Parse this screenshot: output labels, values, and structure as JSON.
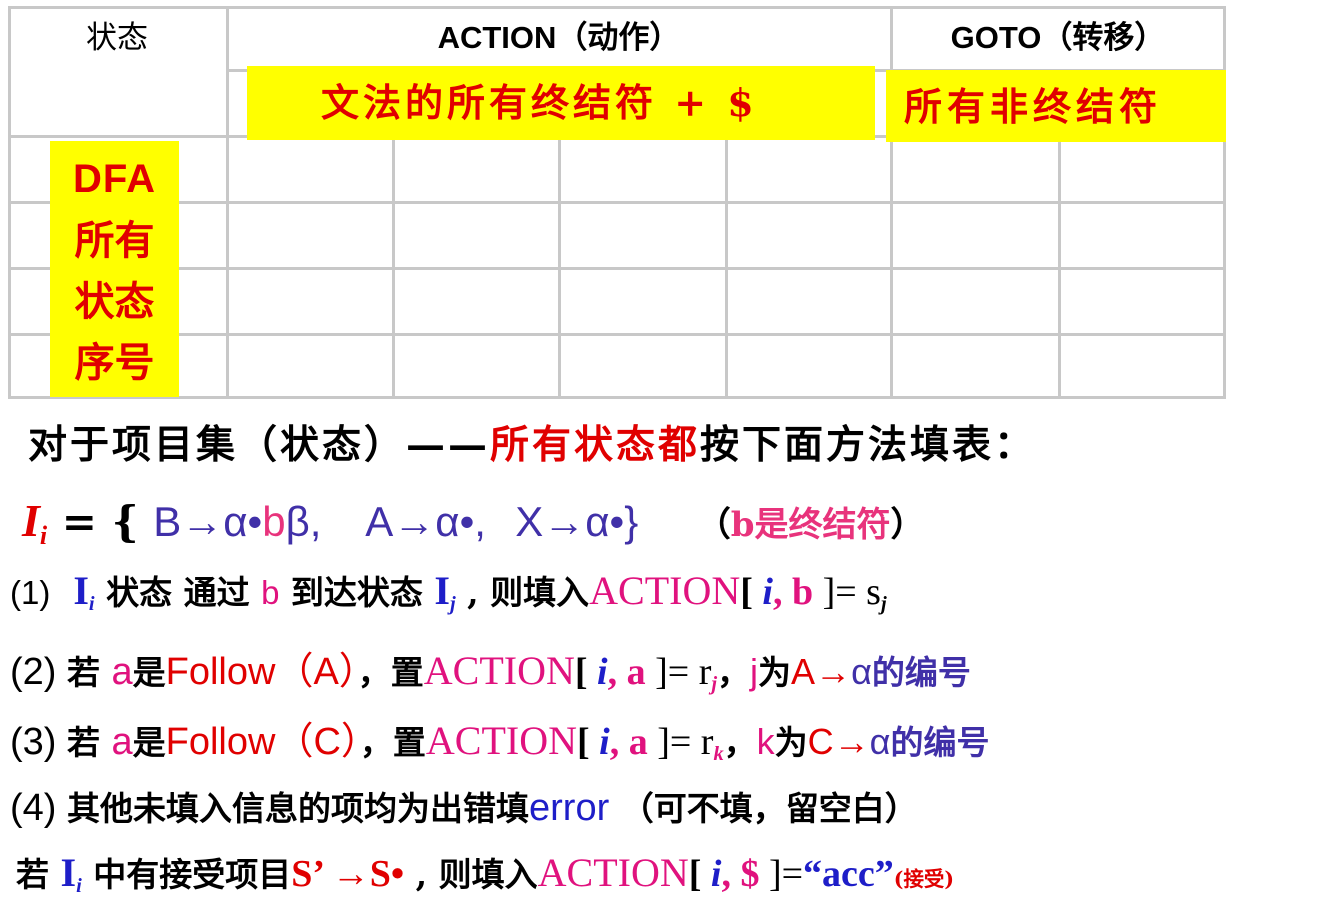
{
  "table": {
    "col_state": "状态",
    "col_action": "ACTION（动作）",
    "col_goto": "GOTO（转移）",
    "action_banner": "文法的所有终结符 + $",
    "goto_banner": "所有非终结符",
    "row_box": [
      "DFA",
      "所有",
      "状态",
      "序号"
    ]
  },
  "heading": {
    "part1": "对于项目集（状态）——",
    "part2": "所有状态都",
    "part3": "按下面方法填表："
  },
  "itemset": {
    "I": "I",
    "i": "i",
    "eq": " = { ",
    "b_to": "B→α•",
    "b": "b",
    "beta": "β,",
    "a_item": "A→α•,",
    "x_item": "X→α•}",
    "note_open": "（",
    "note_b": "b是终结符",
    "note_close": "）"
  },
  "rule1": {
    "num": "(1)",
    "Ii": "I",
    "i": "i",
    "t1": " 状态 通过 ",
    "b": "b",
    "t2": " 到达状态 ",
    "Ij": "I",
    "j": "j",
    "t3": " , 则填入",
    "action": "ACTION",
    "bracket_open": "[ ",
    "idx_i": "i",
    "comma_b": ", b ",
    "bracket_close": "]= s",
    "sj": "j"
  },
  "rule2": {
    "num": "(2) ",
    "ruo": "若 ",
    "a": "a",
    "shi": "是",
    "follow": "Follow（A）",
    "zhi": "，置",
    "action": "ACTION",
    "bracket_open": "[ ",
    "idx_i": "i",
    "comma_a": ", a ",
    "bracket_close": "]= r",
    "sub": "j",
    "sep": "，",
    "j": "j",
    "wei": "为",
    "prod": "A→",
    "alpha": "α",
    "tail": "的编号"
  },
  "rule3": {
    "num": "(3) ",
    "ruo": "若 ",
    "a": "a",
    "shi": "是",
    "follow": "Follow（C）",
    "zhi": "，置",
    "action": "ACTION",
    "bracket_open": "[ ",
    "idx_i": "i",
    "comma_a": ", a ",
    "bracket_close": "]= r",
    "sub": "k",
    "sep": "，",
    "k": "k",
    "wei": "为",
    "prod": "C→",
    "alpha": "α",
    "tail": "的编号"
  },
  "rule4": {
    "num": "(4) ",
    "t1": "其他未填入信息的项均为出错填",
    "error": "error",
    "t2": " （可不填，留空白）"
  },
  "accept": {
    "ruo": "若 ",
    "I": "I",
    "i": "i",
    "t1": " 中有接受项目",
    "item": "S’ →S•",
    "t2": " , 则填入",
    "action": "ACTION",
    "bracket_open": "[ ",
    "idx_i": "i",
    "dollar": ", $ ",
    "bracket_close": "]=",
    "acc": "“acc”",
    "note": "(接受)"
  }
}
